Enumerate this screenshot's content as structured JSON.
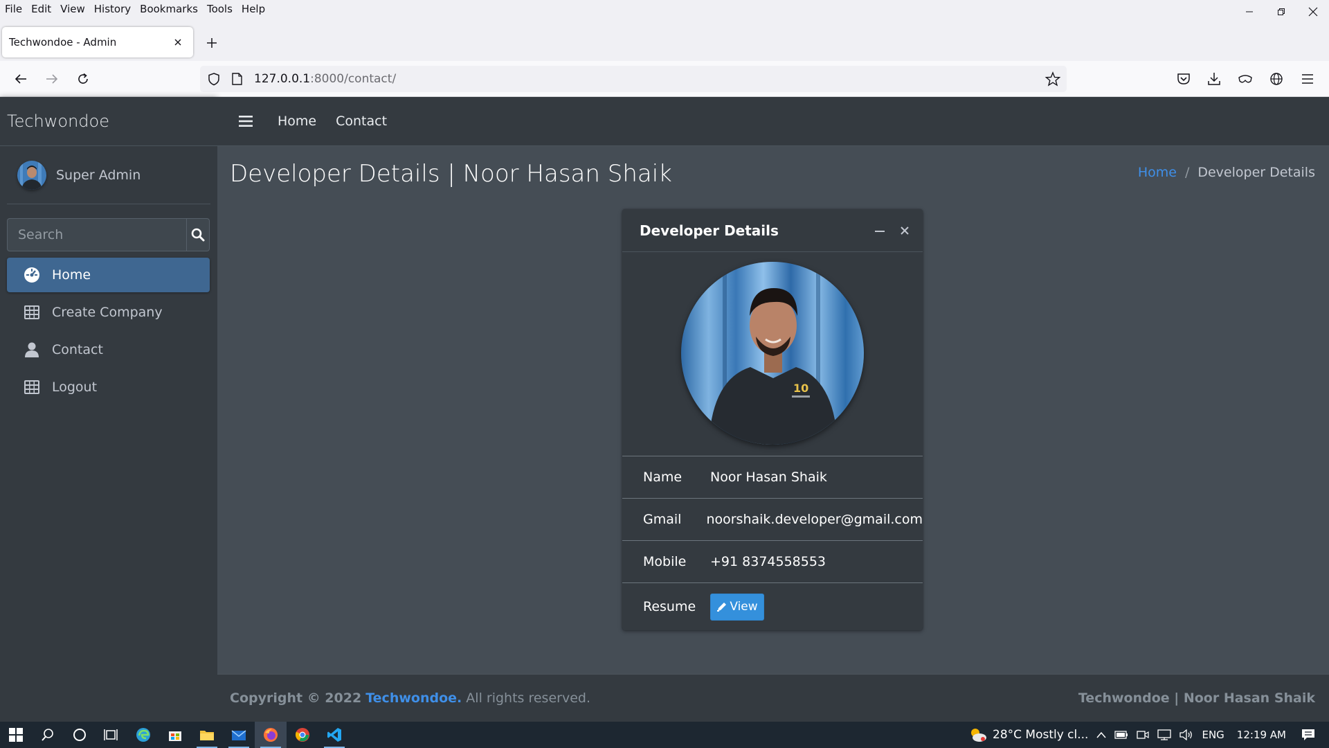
{
  "browser": {
    "menu": [
      "File",
      "Edit",
      "View",
      "History",
      "Bookmarks",
      "Tools",
      "Help"
    ],
    "tab_title": "Techwondoe - Admin",
    "url_host": "127.0.0.1",
    "url_rest": ":8000/contact/"
  },
  "sidebar": {
    "brand": "Techwondoe",
    "user_name": "Super Admin",
    "search_placeholder": "Search",
    "items": [
      {
        "label": "Home",
        "icon": "dashboard-icon",
        "active": true
      },
      {
        "label": "Create Company",
        "icon": "table-icon",
        "active": false
      },
      {
        "label": "Contact",
        "icon": "user-icon",
        "active": false
      },
      {
        "label": "Logout",
        "icon": "table-icon",
        "active": false
      }
    ]
  },
  "topnav": {
    "links": [
      "Home",
      "Contact"
    ]
  },
  "page": {
    "title": "Developer Details | Noor Hasan Shaik",
    "breadcrumb_home": "Home",
    "breadcrumb_sep": "/",
    "breadcrumb_current": "Developer Details"
  },
  "card": {
    "title": "Developer Details",
    "rows": [
      {
        "label": "Name",
        "value": "Noor Hasan Shaik"
      },
      {
        "label": "Gmail",
        "value": "noorshaik.developer@gmail.com"
      },
      {
        "label": "Mobile",
        "value": "+91 8374558553"
      }
    ],
    "resume_label": "Resume",
    "resume_button": "View",
    "accent": "#3490dc"
  },
  "footer": {
    "copyright_prefix": "Copyright © 2022",
    "copyright_link": "Techwondoe.",
    "copyright_suffix": "All rights reserved.",
    "right": "Techwondoe | Noor Hasan Shaik"
  },
  "taskbar": {
    "weather": "28°C  Mostly cl...",
    "language": "ENG",
    "time": "12:19 AM"
  }
}
